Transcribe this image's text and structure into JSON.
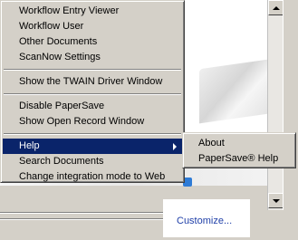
{
  "menu": {
    "items": [
      {
        "label": "Workflow Entry Viewer"
      },
      {
        "label": "Workflow User"
      },
      {
        "label": "Other Documents"
      },
      {
        "label": "ScanNow Settings"
      },
      {
        "label": "Show the TWAIN Driver Window"
      },
      {
        "label": "Disable PaperSave"
      },
      {
        "label": "Show Open Record Window"
      },
      {
        "label": "Help"
      },
      {
        "label": "Search Documents"
      },
      {
        "label": "Change integration mode to Web"
      }
    ]
  },
  "submenu": {
    "items": [
      {
        "label": "About"
      },
      {
        "label": "PaperSave® Help"
      }
    ]
  },
  "customize": {
    "label": "Customize..."
  },
  "colors": {
    "selection": "#0a246a",
    "menu_bg": "#d4d0c8",
    "link": "#1f3fa8"
  }
}
